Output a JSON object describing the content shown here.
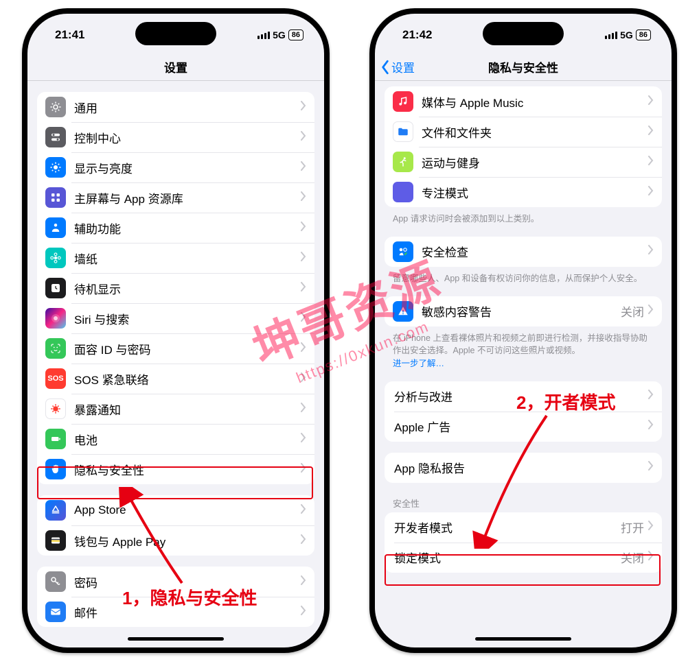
{
  "status": {
    "time_left": "21:41",
    "time_right": "21:42",
    "network": "5G",
    "battery": "86"
  },
  "left": {
    "title": "设置",
    "groups": [
      {
        "items": [
          {
            "icon": "gear",
            "bg": "ic-gray",
            "label": "通用"
          },
          {
            "icon": "switches",
            "bg": "ic-dgray",
            "label": "控制中心"
          },
          {
            "icon": "sun",
            "bg": "ic-blue",
            "label": "显示与亮度"
          },
          {
            "icon": "grid",
            "bg": "ic-indigo",
            "label": "主屏幕与 App 资源库"
          },
          {
            "icon": "person",
            "bg": "ic-blue",
            "label": "辅助功能"
          },
          {
            "icon": "flower",
            "bg": "ic-teal",
            "label": "墙纸"
          },
          {
            "icon": "clock",
            "bg": "ic-black",
            "label": "待机显示"
          },
          {
            "icon": "siri",
            "bg": "ic-siri",
            "label": "Siri 与搜索"
          },
          {
            "icon": "face",
            "bg": "ic-green",
            "label": "面容 ID 与密码"
          },
          {
            "icon": "sos",
            "bg": "ic-red",
            "label": "SOS 紧急联络"
          },
          {
            "icon": "virus",
            "bg": "ic-white",
            "label": "暴露通知"
          },
          {
            "icon": "battery",
            "bg": "ic-green",
            "label": "电池"
          },
          {
            "icon": "hand",
            "bg": "ic-blue",
            "label": "隐私与安全性"
          }
        ]
      },
      {
        "items": [
          {
            "icon": "appstore",
            "bg": "ic-apps",
            "label": "App Store"
          },
          {
            "icon": "wallet",
            "bg": "ic-black",
            "label": "钱包与 Apple Pay"
          }
        ]
      },
      {
        "items": [
          {
            "icon": "key",
            "bg": "ic-key",
            "label": "密码"
          },
          {
            "icon": "mail",
            "bg": "ic-mail",
            "label": "邮件"
          }
        ]
      }
    ]
  },
  "right": {
    "back": "设置",
    "title": "隐私与安全性",
    "group1": [
      {
        "icon": "music",
        "bg": "ic-music",
        "label": "媒体与 Apple Music"
      },
      {
        "icon": "folder",
        "bg": "ic-folder",
        "label": "文件和文件夹"
      },
      {
        "icon": "run",
        "bg": "ic-lime",
        "label": "运动与健身"
      },
      {
        "icon": "moon",
        "bg": "ic-purple",
        "label": "专注模式"
      }
    ],
    "footer1": "App 请求访问时会被添加到以上类别。",
    "group2": [
      {
        "icon": "shield",
        "bg": "ic-shield",
        "label": "安全检查"
      }
    ],
    "footer2": "留意哪些人、App 和设备有权访问你的信息，从而保护个人安全。",
    "group3": [
      {
        "icon": "warn",
        "bg": "ic-warn",
        "label": "敏感内容警告",
        "value": "关闭"
      }
    ],
    "footer3_a": "在 iPhone 上查看裸体照片和视频之前即进行检测，并接收指导协助作出安全选择。Apple 不可访问这些照片或视频。",
    "footer3_link": "进一步了解…",
    "group4": [
      {
        "label": "分析与改进"
      },
      {
        "label": "Apple 广告"
      }
    ],
    "group5": [
      {
        "label": "App 隐私报告"
      }
    ],
    "header6": "安全性",
    "group6": [
      {
        "label": "开发者模式",
        "value": "打开"
      },
      {
        "label": "锁定模式",
        "value": "关闭"
      }
    ]
  },
  "annotations": {
    "a1": "1，隐私与安全性",
    "a2": "2，开者模式"
  },
  "watermark": {
    "line1": "坤哥资源",
    "line2": "https://0xkun.com"
  }
}
